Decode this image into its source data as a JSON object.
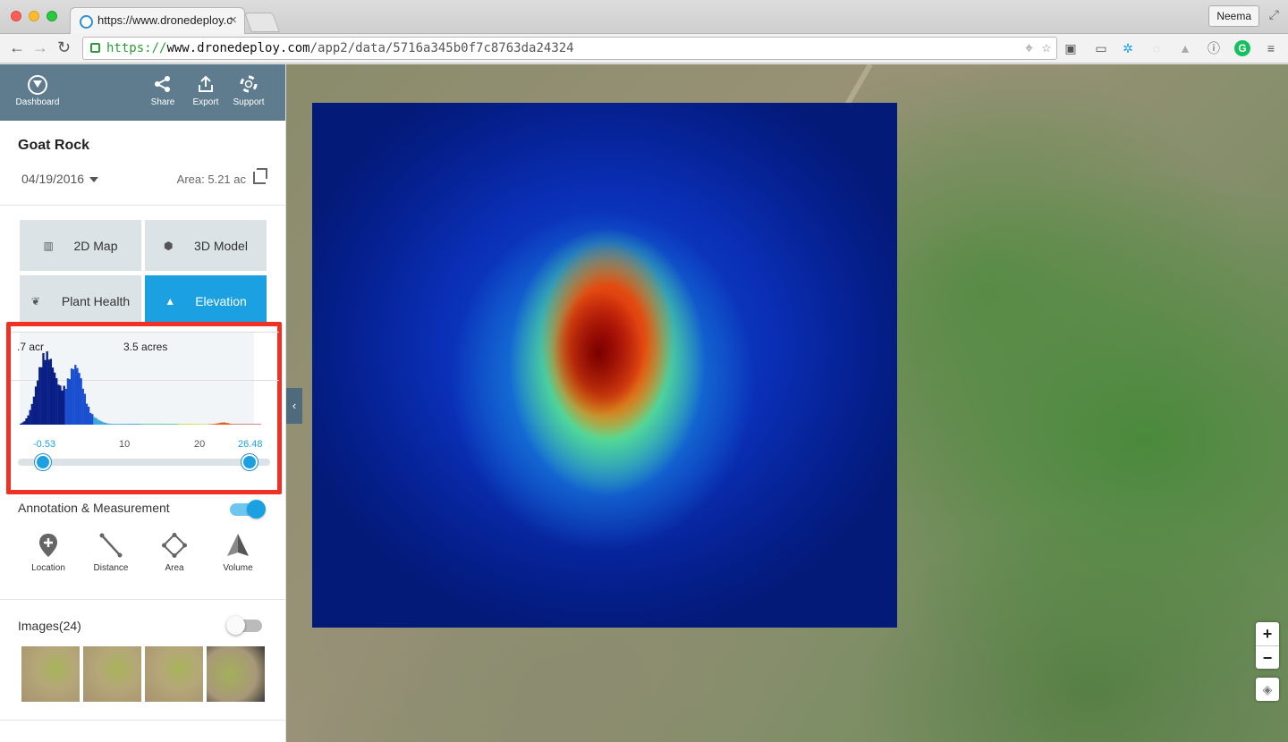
{
  "browser": {
    "tab_title": "https://www.dronedeploy.c",
    "profile_name": "Neema",
    "url_scheme": "https://",
    "url_host": "www.dronedeploy.com",
    "url_path": "/app2/data/5716a345b0f7c8763da24324"
  },
  "header": {
    "dashboard_label": "Dashboard",
    "share_label": "Share",
    "export_label": "Export",
    "support_label": "Support"
  },
  "project": {
    "title": "Goat Rock",
    "date": "04/19/2016",
    "area": "Area:  5.21 ac"
  },
  "views": {
    "map2d": "2D Map",
    "model3d": "3D Model",
    "plant_health": "Plant Health",
    "elevation": "Elevation",
    "active": "Elevation"
  },
  "histogram": {
    "left_text": ".7 acr",
    "mid_text": "3.5 acres",
    "min_label": "-0.53",
    "tick_10": "10",
    "tick_20": "20",
    "max_label": "26.48",
    "range_min": -0.53,
    "range_max": 26.48
  },
  "annotation": {
    "label": "Annotation & Measurement",
    "enabled": true,
    "tools": [
      "Location",
      "Distance",
      "Area",
      "Volume"
    ]
  },
  "images": {
    "label": "Images(24)",
    "enabled": false
  },
  "map": {
    "zoom_in": "+",
    "zoom_out": "−"
  },
  "colors": {
    "accent": "#1ba1e2",
    "header_bg": "#5f7c8e",
    "highlight_box": "#ee3124"
  }
}
